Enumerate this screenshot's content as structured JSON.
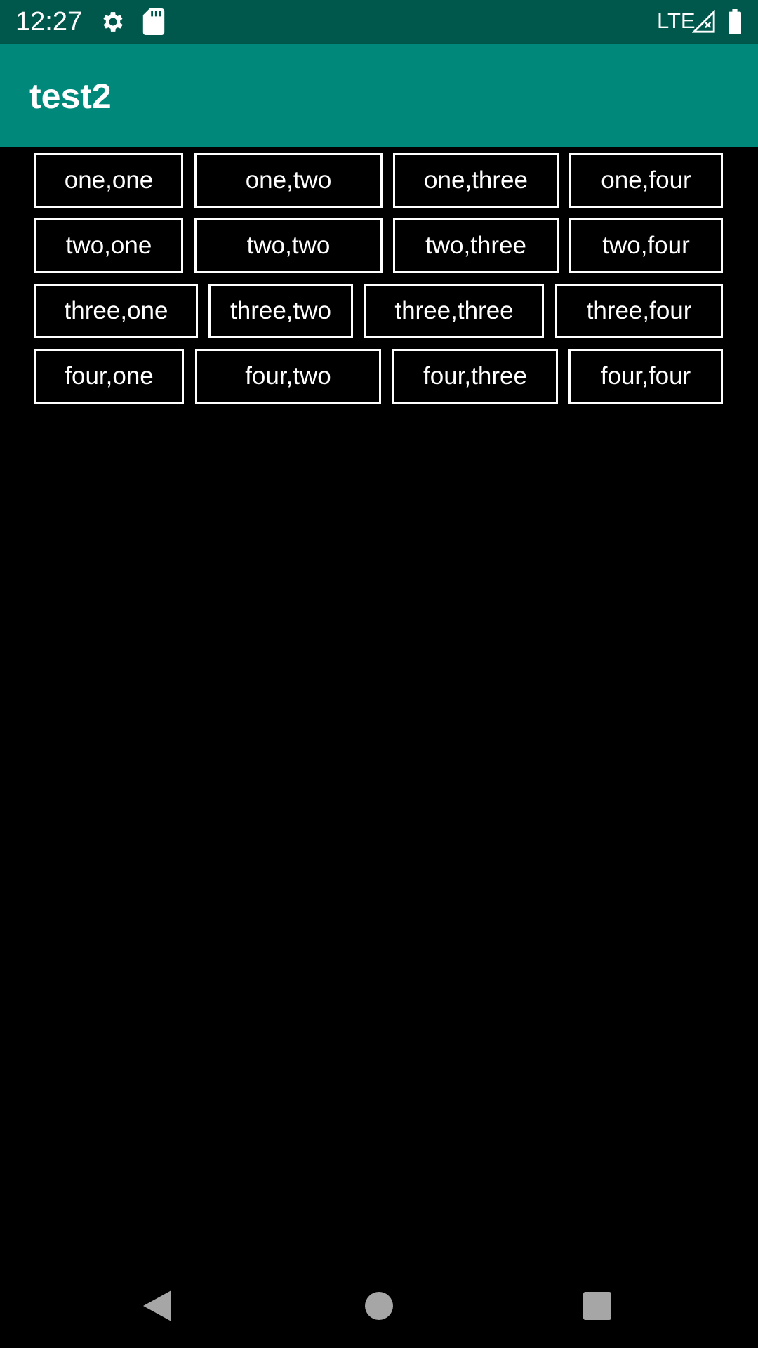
{
  "status_bar": {
    "time": "12:27",
    "network": "LTE",
    "icons": [
      "settings-icon",
      "sd-card-icon",
      "signal-icon",
      "battery-icon"
    ]
  },
  "app_bar": {
    "title": "test2",
    "color": "#00897B",
    "status_color": "#00584C"
  },
  "grid": {
    "rows": [
      [
        "one,one",
        "one,two",
        "one,three",
        "one,four"
      ],
      [
        "two,one",
        "two,two",
        "two,three",
        "two,four"
      ],
      [
        "three,one",
        "three,two",
        "three,three",
        "three,four"
      ],
      [
        "four,one",
        "four,two",
        "four,three",
        "four,four"
      ]
    ]
  },
  "nav_bar": {
    "icons": [
      "back-icon",
      "home-icon",
      "recents-icon"
    ]
  }
}
